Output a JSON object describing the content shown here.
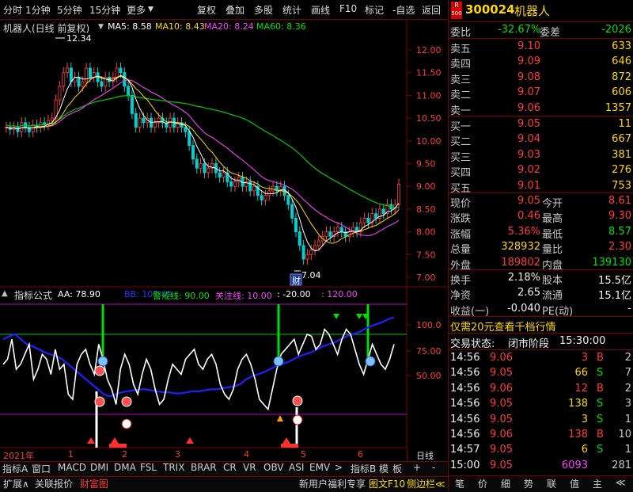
{
  "toolbar": {
    "items": [
      "分时",
      "1分钟",
      "5分钟",
      "15分钟",
      "更多",
      "复权",
      "叠加",
      "多股",
      "统计",
      "画线",
      "F10",
      "标记",
      "-自选",
      "返回"
    ]
  },
  "main_chart": {
    "title": "机器人(日线 前复权)",
    "ma": [
      {
        "label": "MA5: 8.58",
        "color": "#ffffff"
      },
      {
        "label": "MA10: 8.43",
        "color": "#ffd800"
      },
      {
        "label": "MA20: 8.24",
        "color": "#ff40ff"
      },
      {
        "label": "MA60: 8.36",
        "color": "#00e000"
      }
    ],
    "high_label": "12.34",
    "low_label": "7.04",
    "cai_badge": "财",
    "price_axis": [
      "12.00",
      "11.50",
      "11.00",
      "10.50",
      "10.00",
      "9.50",
      "9.00",
      "8.50",
      "8.00",
      "7.50",
      "7.00"
    ]
  },
  "indicator": {
    "title": "指标公式",
    "values": [
      {
        "label": "AA: 78.90",
        "color": "#ffffff"
      },
      {
        "label": "BB: 107.69",
        "color": "#3030ff"
      },
      {
        "label": "警戒线: 90.00",
        "color": "#00e000"
      },
      {
        "label": "关注线: 10.00",
        "color": "#ff40ff"
      },
      {
        "label": ": -20.00",
        "color": "#ffffff"
      },
      {
        "label": ": 120.00",
        "color": "#ff40ff"
      }
    ],
    "axis": [
      "100.0",
      "75.00",
      "50.00"
    ]
  },
  "time_axis": [
    "2021年",
    "1",
    "2",
    "3",
    "4",
    "5",
    "6"
  ],
  "bottom_tabs": {
    "row1": [
      "指标A",
      "窗口",
      "MACD",
      "DMI",
      "DMA",
      "FSL",
      "TRIX",
      "BRAR",
      "CR",
      "VR",
      "OBV",
      "ASI",
      "EMV",
      ">",
      "指标B",
      "模",
      "板",
      "+",
      "-"
    ],
    "row2": [
      "扩展∧",
      "关联报价",
      "财富图"
    ],
    "promo": "新用户福利专享",
    "f10": "图文F10",
    "sidebar": "侧边栏≪"
  },
  "stock": {
    "badge_top": "R",
    "badge_bottom": "500",
    "code": "300024",
    "name": "机器人",
    "weibi_label": "委比",
    "weibi": "-32.67%",
    "weicha_label": "委差",
    "weicha": "-2026"
  },
  "asks": [
    {
      "label": "卖五",
      "price": "9.10",
      "vol": "633"
    },
    {
      "label": "卖四",
      "price": "9.09",
      "vol": "646"
    },
    {
      "label": "卖三",
      "price": "9.08",
      "vol": "872"
    },
    {
      "label": "卖二",
      "price": "9.07",
      "vol": "606"
    },
    {
      "label": "卖一",
      "price": "9.06",
      "vol": "1357"
    }
  ],
  "bids": [
    {
      "label": "买一",
      "price": "9.05",
      "vol": "11"
    },
    {
      "label": "买二",
      "price": "9.04",
      "vol": "667"
    },
    {
      "label": "买三",
      "price": "9.03",
      "vol": "381"
    },
    {
      "label": "买四",
      "price": "9.02",
      "vol": "276"
    },
    {
      "label": "买五",
      "price": "9.01",
      "vol": "753"
    }
  ],
  "quote": [
    {
      "l1": "现价",
      "v1": "9.05",
      "c1": "red",
      "l2": "今开",
      "v2": "8.61",
      "c2": "red"
    },
    {
      "l1": "涨跌",
      "v1": "0.46",
      "c1": "red",
      "l2": "最高",
      "v2": "9.30",
      "c2": "red"
    },
    {
      "l1": "涨幅",
      "v1": "5.36%",
      "c1": "red",
      "l2": "最低",
      "v2": "8.57",
      "c2": "green"
    },
    {
      "l1": "总量",
      "v1": "328932",
      "c1": "yellow",
      "l2": "量比",
      "v2": "2.30",
      "c2": "red"
    },
    {
      "l1": "外盘",
      "v1": "189802",
      "c1": "red",
      "l2": "内盘",
      "v2": "139130",
      "c2": "green"
    }
  ],
  "stats": [
    {
      "l1": "换手",
      "v1": "2.18%",
      "l2": "股本",
      "v2": "15.5亿"
    },
    {
      "l1": "净资",
      "v1": "2.65",
      "l2": "流通",
      "v2": "15.1亿"
    },
    {
      "l1": "收益(一)",
      "v1": "-0.040",
      "l2": "PE(动)",
      "v2": "-"
    }
  ],
  "promo_line": "仅需20元查看千档行情",
  "trade_status": {
    "label": "交易状态:",
    "status": "闭市阶段",
    "time": "15:30:00"
  },
  "ticks": [
    {
      "time": "14:56",
      "price": "9.06",
      "vol": "3",
      "side": "B",
      "num": "2"
    },
    {
      "time": "14:56",
      "price": "9.05",
      "vol": "66",
      "side": "S",
      "num": "7"
    },
    {
      "time": "14:56",
      "price": "9.06",
      "vol": "12",
      "side": "B",
      "num": "2"
    },
    {
      "time": "14:56",
      "price": "9.05",
      "vol": "138",
      "side": "S",
      "num": "3"
    },
    {
      "time": "14:56",
      "price": "9.05",
      "vol": "3",
      "side": "S",
      "num": "1"
    },
    {
      "time": "14:56",
      "price": "9.06",
      "vol": "138",
      "side": "B",
      "num": "10"
    },
    {
      "time": "14:57",
      "price": "9.05",
      "vol": "6",
      "side": "S",
      "num": "1"
    },
    {
      "time": "15:00",
      "price": "9.05",
      "vol": "6093",
      "side": "",
      "num": "281"
    }
  ],
  "right_bottom_tab": "日线",
  "right_tabs": [
    "笔",
    "价",
    "细",
    "势",
    "联",
    "值",
    "主",
    "≪"
  ]
}
